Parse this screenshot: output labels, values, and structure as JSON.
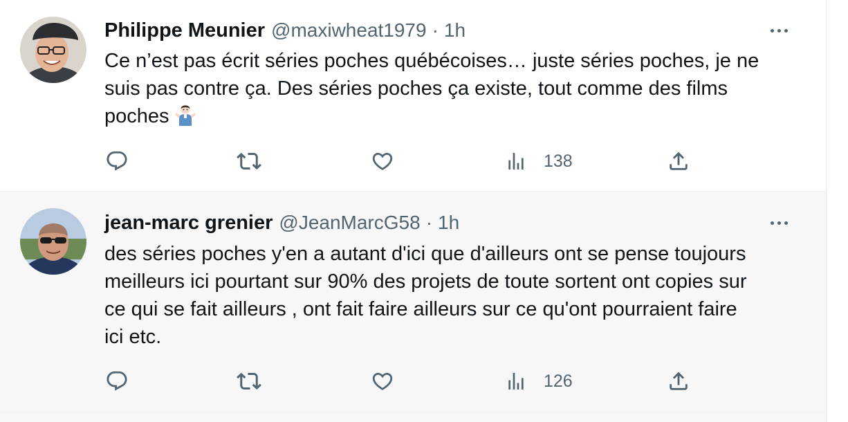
{
  "tweets": [
    {
      "author_name": "Philippe Meunier",
      "handle": "@maxiwheat1979",
      "separator": "·",
      "time": "1h",
      "lines": [
        "Ce n’est pas écrit séries poches québécoises… juste séries poches, je ne",
        "suis pas contre ça. Des séries poches ça existe, tout comme des films",
        "poches"
      ],
      "emoji": "person-shrugging-emoji",
      "views": "138",
      "icons": [
        "reply-icon",
        "retweet-icon",
        "like-icon",
        "views-icon",
        "share-icon",
        "more-icon"
      ]
    },
    {
      "author_name": "jean-marc grenier",
      "handle": "@JeanMarcG58",
      "separator": "·",
      "time": "1h",
      "lines": [
        "des séries poches y'en a autant d'ici que d'ailleurs ont se pense toujours",
        "meilleurs ici pourtant sur 90% des projets de toute sortent ont copies sur",
        "ce qui se fait ailleurs , ont fait faire ailleurs sur ce qu'ont pourraient faire",
        "ici etc."
      ],
      "views": "126",
      "icons": [
        "reply-icon",
        "retweet-icon",
        "like-icon",
        "views-icon",
        "share-icon",
        "more-icon"
      ]
    }
  ],
  "colors": {
    "text_primary": "#0f1419",
    "text_secondary": "#536471",
    "hover_background": "#f7f7f7",
    "divider": "#eff3f4"
  }
}
